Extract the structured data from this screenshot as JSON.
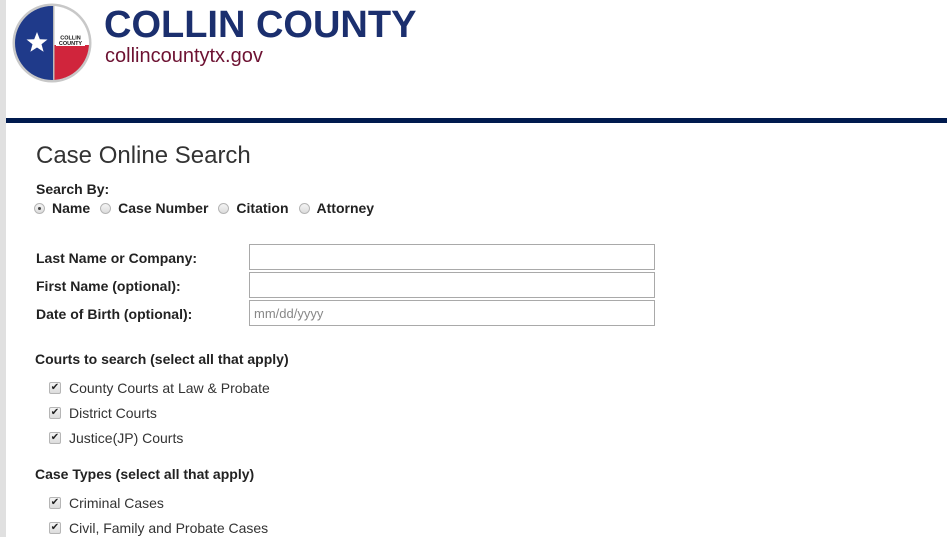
{
  "header": {
    "brand_title": "COLLIN COUNTY",
    "brand_url": "collincountytx.gov",
    "logo_text_line1": "COLLIN",
    "logo_text_line2": "COUNTY",
    "colors": {
      "navy": "#1b2f6e",
      "maroon": "#6d1232",
      "rule": "#001a4e",
      "flag_blue": "#1f3a8a",
      "flag_red": "#d0253c"
    }
  },
  "page": {
    "title": "Case Online Search",
    "search_by": {
      "label": "Search By:",
      "options": [
        {
          "label": "Name",
          "checked": true
        },
        {
          "label": "Case Number",
          "checked": false
        },
        {
          "label": "Citation",
          "checked": false
        },
        {
          "label": "Attorney",
          "checked": false
        }
      ]
    },
    "fields": [
      {
        "label": "Last Name or Company:",
        "value": "",
        "placeholder": ""
      },
      {
        "label": "First Name (optional):",
        "value": "",
        "placeholder": ""
      },
      {
        "label": "Date of Birth (optional):",
        "value": "",
        "placeholder": "mm/dd/yyyy"
      }
    ],
    "courts": {
      "label": "Courts to search (select all that apply)",
      "items": [
        {
          "label": "County Courts at Law & Probate",
          "checked": true
        },
        {
          "label": "District Courts",
          "checked": true
        },
        {
          "label": "Justice(JP) Courts",
          "checked": true
        }
      ]
    },
    "case_types": {
      "label": "Case Types (select all that apply)",
      "items": [
        {
          "label": "Criminal Cases",
          "checked": true
        },
        {
          "label": "Civil, Family and Probate Cases",
          "checked": true
        }
      ]
    },
    "check_glyph": "✔"
  }
}
